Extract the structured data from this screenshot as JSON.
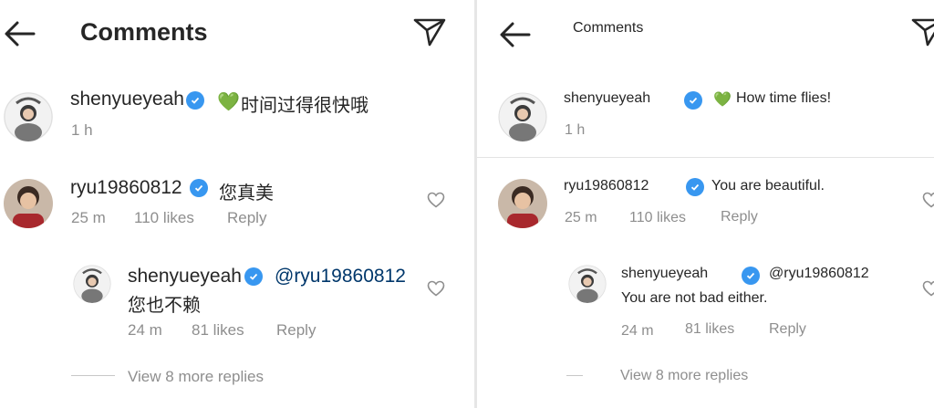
{
  "left": {
    "header": {
      "title": "Comments",
      "back_icon": "arrow-left-icon",
      "share_icon": "paper-plane-icon"
    },
    "caption": {
      "username": "shenyueyeah",
      "emoji": "💚",
      "text": "时间过得很快哦",
      "time": "1 h"
    },
    "comment": {
      "username": "ryu19860812",
      "text": "您真美",
      "time": "25 m",
      "likes": "110 likes",
      "reply": "Reply"
    },
    "reply": {
      "username": "shenyueyeah",
      "mention": "@ryu19860812",
      "text": "您也不赖",
      "time": "24 m",
      "likes": "81 likes",
      "reply": "Reply"
    },
    "view_more": "View 8 more replies"
  },
  "right": {
    "header": {
      "title": "Comments",
      "back_icon": "arrow-left-icon",
      "share_icon": "paper-plane-icon"
    },
    "caption": {
      "username": "shenyueyeah",
      "emoji": "💚",
      "text": "How time flies!",
      "time": "1 h"
    },
    "comment": {
      "username": "ryu19860812",
      "text": "You are beautiful.",
      "time": "25 m",
      "likes": "110 likes",
      "reply": "Reply"
    },
    "reply": {
      "username": "shenyueyeah",
      "mention": "@ryu19860812",
      "text": "You are not bad either.",
      "time": "24 m",
      "likes": "81 likes",
      "reply": "Reply"
    },
    "view_more": "View 8 more replies"
  },
  "colors": {
    "verified": "#3897f0",
    "heart": "#4caf50",
    "muted": "#8e8e8e",
    "text": "#262626"
  }
}
